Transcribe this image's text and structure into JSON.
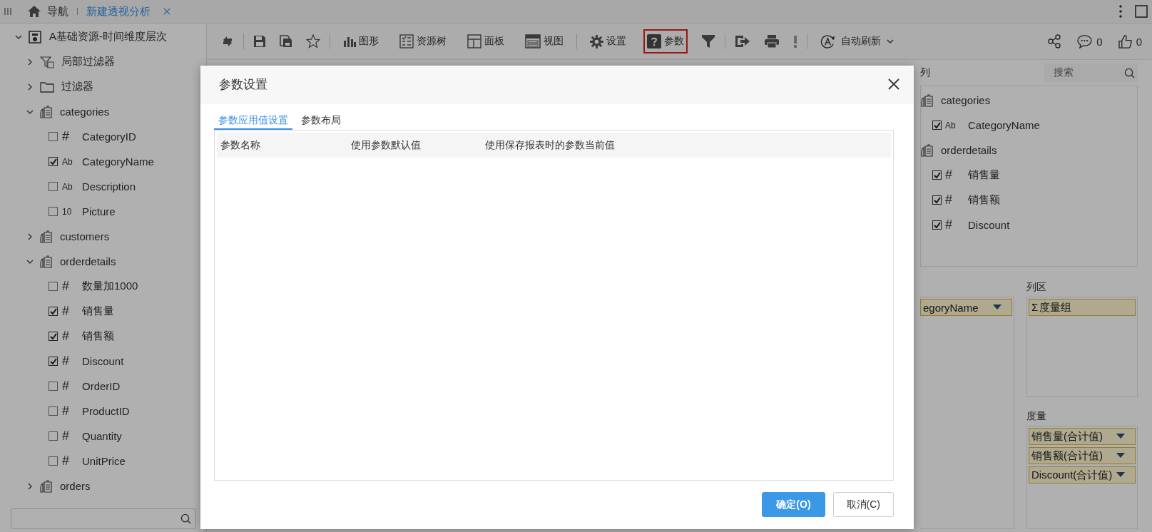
{
  "topbar": {
    "tabs": [
      {
        "label": "导航",
        "kind": "home",
        "selected": false
      },
      {
        "label": "新建透视分析",
        "kind": "doc",
        "selected": true
      }
    ]
  },
  "resource_tree": {
    "label": "A基础资源-时间维度层次",
    "expanded": true,
    "children": [
      {
        "label": "局部过滤器",
        "kind": "filter",
        "expanded": false
      },
      {
        "label": "过滤器",
        "kind": "folder",
        "expanded": false
      },
      {
        "label": "categories",
        "kind": "table",
        "expanded": true,
        "children": [
          {
            "label": "CategoryID",
            "type_label": "#",
            "checked": false
          },
          {
            "label": "CategoryName",
            "type_label": "Ab",
            "checked": true
          },
          {
            "label": "Description",
            "type_label": "Ab",
            "checked": false
          },
          {
            "label": "Picture",
            "type_label": "10",
            "checked": false
          }
        ]
      },
      {
        "label": "customers",
        "kind": "table",
        "expanded": false
      },
      {
        "label": "orderdetails",
        "kind": "table",
        "expanded": true,
        "children": [
          {
            "label": "数量加1000",
            "type_label": "#",
            "checked": false
          },
          {
            "label": "销售量",
            "type_label": "#",
            "checked": true
          },
          {
            "label": "销售额",
            "type_label": "#",
            "checked": true
          },
          {
            "label": "Discount",
            "type_label": "#",
            "checked": true
          },
          {
            "label": "OrderID",
            "type_label": "#",
            "checked": false
          },
          {
            "label": "ProductID",
            "type_label": "#",
            "checked": false
          },
          {
            "label": "Quantity",
            "type_label": "#",
            "checked": false
          },
          {
            "label": "UnitPrice",
            "type_label": "#",
            "checked": false
          }
        ]
      },
      {
        "label": "orders",
        "kind": "table",
        "expanded": false
      }
    ]
  },
  "toolbar": {
    "items": [
      {
        "kind": "refresh"
      },
      {
        "kind": "separator"
      },
      {
        "kind": "save"
      },
      {
        "kind": "save-as"
      },
      {
        "kind": "star"
      },
      {
        "kind": "separator"
      },
      {
        "kind": "chart",
        "label": "图形",
        "highlighted": false
      },
      {
        "kind": "tree",
        "label": "资源树",
        "highlighted": false
      },
      {
        "kind": "panel",
        "label": "面板",
        "highlighted": false
      },
      {
        "kind": "view",
        "label": "视图",
        "highlighted": false
      },
      {
        "kind": "separator"
      },
      {
        "kind": "gear",
        "label": "设置",
        "highlighted": false
      },
      {
        "kind": "param",
        "label": "参数",
        "highlighted": true
      },
      {
        "kind": "filter"
      },
      {
        "kind": "separator"
      },
      {
        "kind": "export"
      },
      {
        "kind": "print"
      },
      {
        "kind": "alert"
      },
      {
        "kind": "separator"
      },
      {
        "kind": "autorefresh",
        "label": "自动刷新"
      }
    ],
    "right": [
      {
        "kind": "share"
      },
      {
        "kind": "comment",
        "count": "0"
      },
      {
        "kind": "like",
        "count": "0"
      }
    ]
  },
  "right_panel": {
    "header": "列",
    "search": {
      "placeholder": "搜索"
    },
    "tree": [
      {
        "label": "categories",
        "children": [
          {
            "label": "CategoryName",
            "type_label": "Ab",
            "checked": true
          }
        ]
      },
      {
        "label": "orderdetails",
        "children": [
          {
            "label": "销售量",
            "type_label": "#",
            "checked": true
          },
          {
            "label": "销售额",
            "type_label": "#",
            "checked": true
          },
          {
            "label": "Discount",
            "type_label": "#",
            "checked": true
          }
        ]
      }
    ],
    "row_zone": {
      "chips": [
        {
          "label": "egoryName"
        }
      ]
    },
    "column_zone": {
      "title": "列区",
      "chips": [
        {
          "symbol": "Σ",
          "label": "度量组"
        }
      ]
    },
    "measure_zone": {
      "title": "度量",
      "chips": [
        {
          "label": "销售量(合计值)"
        },
        {
          "label": "销售额(合计值)"
        },
        {
          "label": "Discount(合计值)"
        }
      ]
    }
  },
  "dialog": {
    "title": "参数设置",
    "tabs": [
      {
        "label": "参数应用值设置",
        "selected": true
      },
      {
        "label": "参数布局",
        "selected": false
      }
    ],
    "columns": [
      "参数名称",
      "使用参数默认值",
      "使用保存报表时的参数当前值"
    ],
    "buttons": [
      {
        "label": "确定(O)",
        "kind": "primary"
      },
      {
        "label": "取消(C)",
        "kind": "secondary"
      }
    ]
  }
}
